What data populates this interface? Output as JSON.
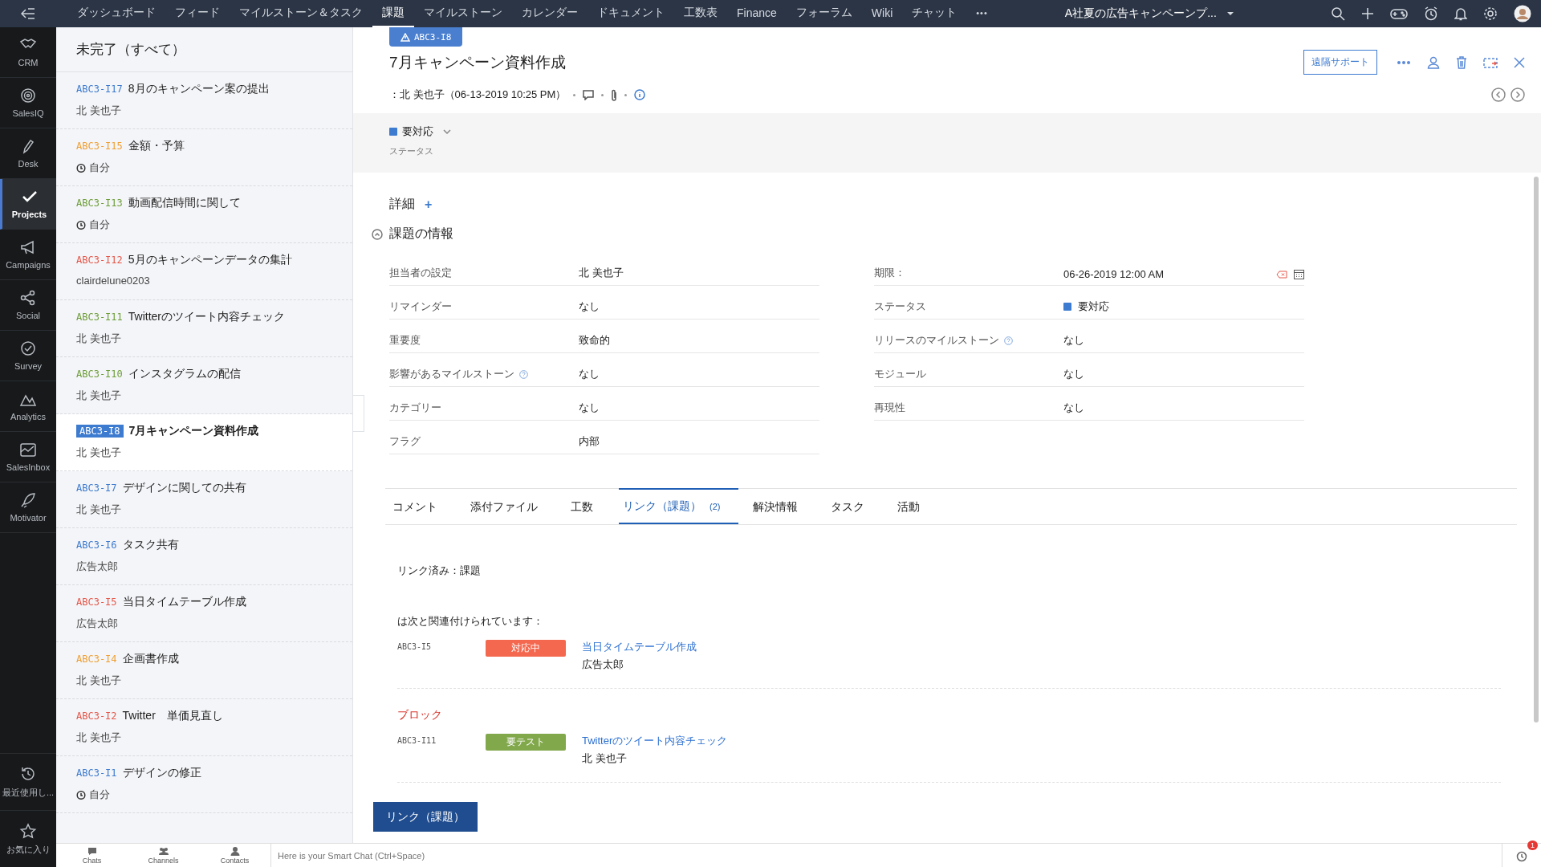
{
  "top_nav": {
    "items": [
      {
        "label": "ダッシュボード",
        "selected": false
      },
      {
        "label": "フィード",
        "selected": false
      },
      {
        "label": "マイルストーン＆タスク",
        "selected": false
      },
      {
        "label": "課題",
        "selected": true
      },
      {
        "label": "マイルストーン",
        "selected": false
      },
      {
        "label": "カレンダー",
        "selected": false
      },
      {
        "label": "ドキュメント",
        "selected": false
      },
      {
        "label": "工数表",
        "selected": false
      },
      {
        "label": "Finance",
        "selected": false
      },
      {
        "label": "フォーラム",
        "selected": false
      },
      {
        "label": "Wiki",
        "selected": false
      },
      {
        "label": "チャット",
        "selected": false
      }
    ],
    "more": "•••",
    "project": "A社夏の広告キャンペーンプ..."
  },
  "rail": {
    "items": [
      {
        "label": "CRM",
        "selected": false
      },
      {
        "label": "SalesIQ",
        "selected": false
      },
      {
        "label": "Desk",
        "selected": false
      },
      {
        "label": "Projects",
        "selected": true
      },
      {
        "label": "Campaigns",
        "selected": false
      },
      {
        "label": "Social",
        "selected": false
      },
      {
        "label": "Survey",
        "selected": false
      },
      {
        "label": "Analytics",
        "selected": false
      },
      {
        "label": "SalesInbox",
        "selected": false
      },
      {
        "label": "Motivator",
        "selected": false
      }
    ],
    "bottom_items": [
      "最近使用し...",
      "お気に入り"
    ]
  },
  "issue_list": {
    "title": "未完了（すべて）",
    "items": [
      {
        "id": "ABC3-I17",
        "title": "8月のキャンペーン案の提出",
        "owner": "北 美也子",
        "kind": "user",
        "color": "#3d7bd0",
        "selected": false
      },
      {
        "id": "ABC3-I15",
        "title": "金額・予算",
        "owner": "自分",
        "kind": "timer",
        "color": "#f0a035",
        "selected": false
      },
      {
        "id": "ABC3-I13",
        "title": "動画配信時間に関して",
        "owner": "自分",
        "kind": "timer",
        "color": "#6e9e3a",
        "selected": false
      },
      {
        "id": "ABC3-I12",
        "title": "5月のキャンペーンデータの集計",
        "owner": "clairdelune0203",
        "kind": "user",
        "color": "#e5574a",
        "selected": false
      },
      {
        "id": "ABC3-I11",
        "title": "Twitterのツイート内容チェック",
        "owner": "北 美也子",
        "kind": "user",
        "color": "#6e9e3a",
        "selected": false
      },
      {
        "id": "ABC3-I10",
        "title": "インスタグラムの配信",
        "owner": "北 美也子",
        "kind": "user",
        "color": "#6e9e3a",
        "selected": false
      },
      {
        "id": "ABC3-I8",
        "title": "7月キャンペーン資料作成",
        "owner": "北 美也子",
        "kind": "user",
        "color": "#3d7bd0",
        "selected": true
      },
      {
        "id": "ABC3-I7",
        "title": "デザインに関しての共有",
        "owner": "北 美也子",
        "kind": "user",
        "color": "#3d7bd0",
        "selected": false
      },
      {
        "id": "ABC3-I6",
        "title": "タスク共有",
        "owner": "広告太郎",
        "kind": "user",
        "color": "#3d7bd0",
        "selected": false
      },
      {
        "id": "ABC3-I5",
        "title": "当日タイムテーブル作成",
        "owner": "広告太郎",
        "kind": "user",
        "color": "#e5574a",
        "selected": false
      },
      {
        "id": "ABC3-I4",
        "title": "企画書作成",
        "owner": "北 美也子",
        "kind": "user",
        "color": "#f0a035",
        "selected": false
      },
      {
        "id": "ABC3-I2",
        "title": "Twitter　単価見直し",
        "owner": "北 美也子",
        "kind": "user",
        "color": "#e5574a",
        "selected": false
      },
      {
        "id": "ABC3-I1",
        "title": "デザインの修正",
        "owner": "自分",
        "kind": "timer",
        "color": "#3d7bd0",
        "selected": false
      }
    ]
  },
  "detail": {
    "tag": "ABC3-I8",
    "title": "7月キャンペーン資料作成",
    "meta": "：北 美也子（06-13-2019 10:25 PM）",
    "remote_button": "遠隔サポート",
    "status": {
      "label": "要対応",
      "color": "#3d7bd0",
      "caption": "ステータス"
    },
    "section": "詳細",
    "add": "+",
    "info_title": "課題の情報",
    "left_fields": [
      {
        "label": "担当者の設定",
        "value": "北 美也子",
        "help": false
      },
      {
        "label": "リマインダー",
        "value": "なし",
        "help": false
      },
      {
        "label": "重要度",
        "value": "致命的",
        "help": false
      },
      {
        "label": "影響があるマイルストーン",
        "value": "なし",
        "help": true
      },
      {
        "label": "カテゴリー",
        "value": "なし",
        "help": false
      },
      {
        "label": "フラグ",
        "value": "内部",
        "help": false
      }
    ],
    "right_fields": [
      {
        "label": "期限：",
        "value": "06-26-2019 12:00 AM",
        "help": false,
        "kind": "date"
      },
      {
        "label": "ステータス",
        "value": "要対応",
        "help": false,
        "kind": "status",
        "color": "#3d7bd0"
      },
      {
        "label": "リリースのマイルストーン",
        "value": "なし",
        "help": true,
        "kind": "text"
      },
      {
        "label": "モジュール",
        "value": "なし",
        "help": false,
        "kind": "text"
      },
      {
        "label": "再現性",
        "value": "なし",
        "help": false,
        "kind": "text"
      }
    ],
    "tabs": [
      {
        "label": "コメント",
        "selected": false
      },
      {
        "label": "添付ファイル",
        "selected": false
      },
      {
        "label": "工数",
        "selected": false
      },
      {
        "label": "リンク（課題）",
        "count": "(2)",
        "selected": true
      },
      {
        "label": "解決情報",
        "selected": false
      },
      {
        "label": "タスク",
        "selected": false
      },
      {
        "label": "活動",
        "selected": false
      }
    ],
    "linked_title": "リンク済み：課題",
    "groups": [
      {
        "title": "は次と関連付けられています：",
        "kind": "related",
        "items": [
          {
            "id": "ABC3-I5",
            "badge": "対応中",
            "color": "#f4684f",
            "title": "当日タイムテーブル作成",
            "owner": "広告太郎"
          }
        ]
      },
      {
        "title": "ブロック",
        "kind": "blocks",
        "items": [
          {
            "id": "ABC3-I11",
            "badge": "要テスト",
            "color": "#82a84c",
            "title": "Twitterのツイート内容チェック",
            "owner": "北 美也子"
          }
        ]
      }
    ],
    "link_button": "リンク（課題）"
  },
  "chat_bar": {
    "tabs": [
      "Chats",
      "Channels",
      "Contacts"
    ],
    "placeholder": "Here is your Smart Chat (Ctrl+Space)",
    "badge": "1"
  }
}
